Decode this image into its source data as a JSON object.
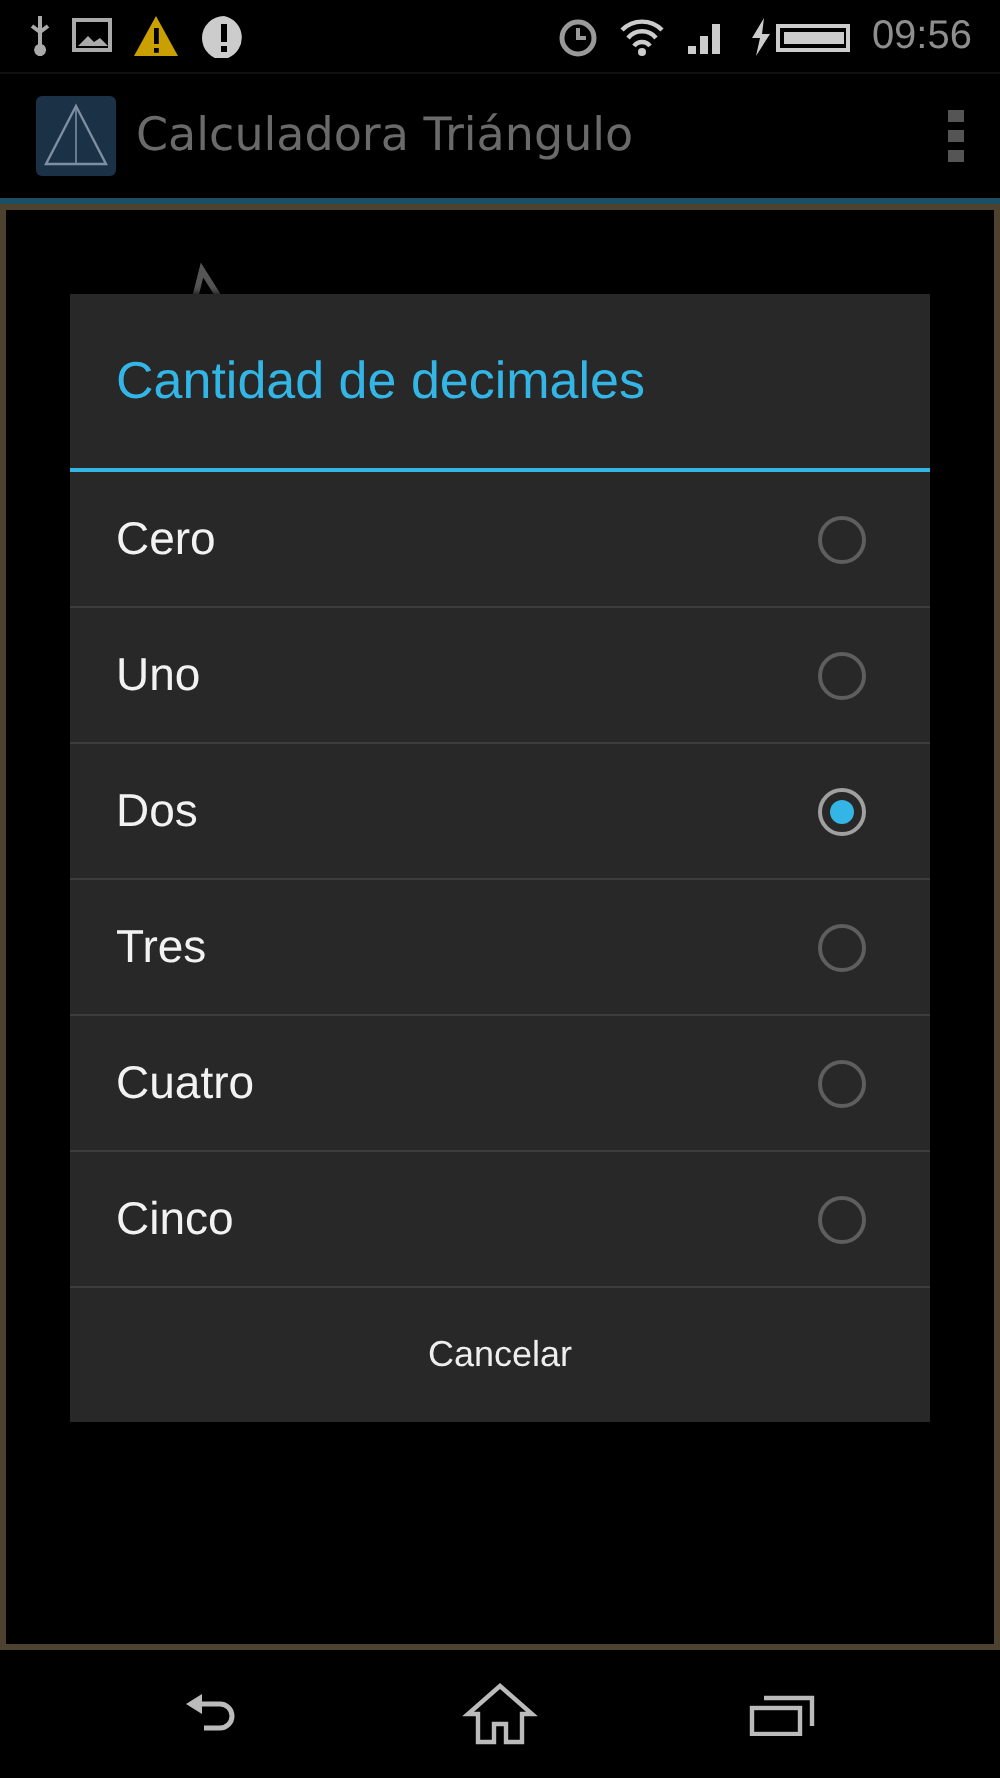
{
  "status_bar": {
    "time": "09:56"
  },
  "action_bar": {
    "title": "Calculadora Triángulo"
  },
  "dialog": {
    "title": "Cantidad de decimales",
    "options": [
      {
        "label": "Cero",
        "selected": false
      },
      {
        "label": "Uno",
        "selected": false
      },
      {
        "label": "Dos",
        "selected": true
      },
      {
        "label": "Tres",
        "selected": false
      },
      {
        "label": "Cuatro",
        "selected": false
      },
      {
        "label": "Cinco",
        "selected": false
      }
    ],
    "cancel": "Cancelar"
  }
}
